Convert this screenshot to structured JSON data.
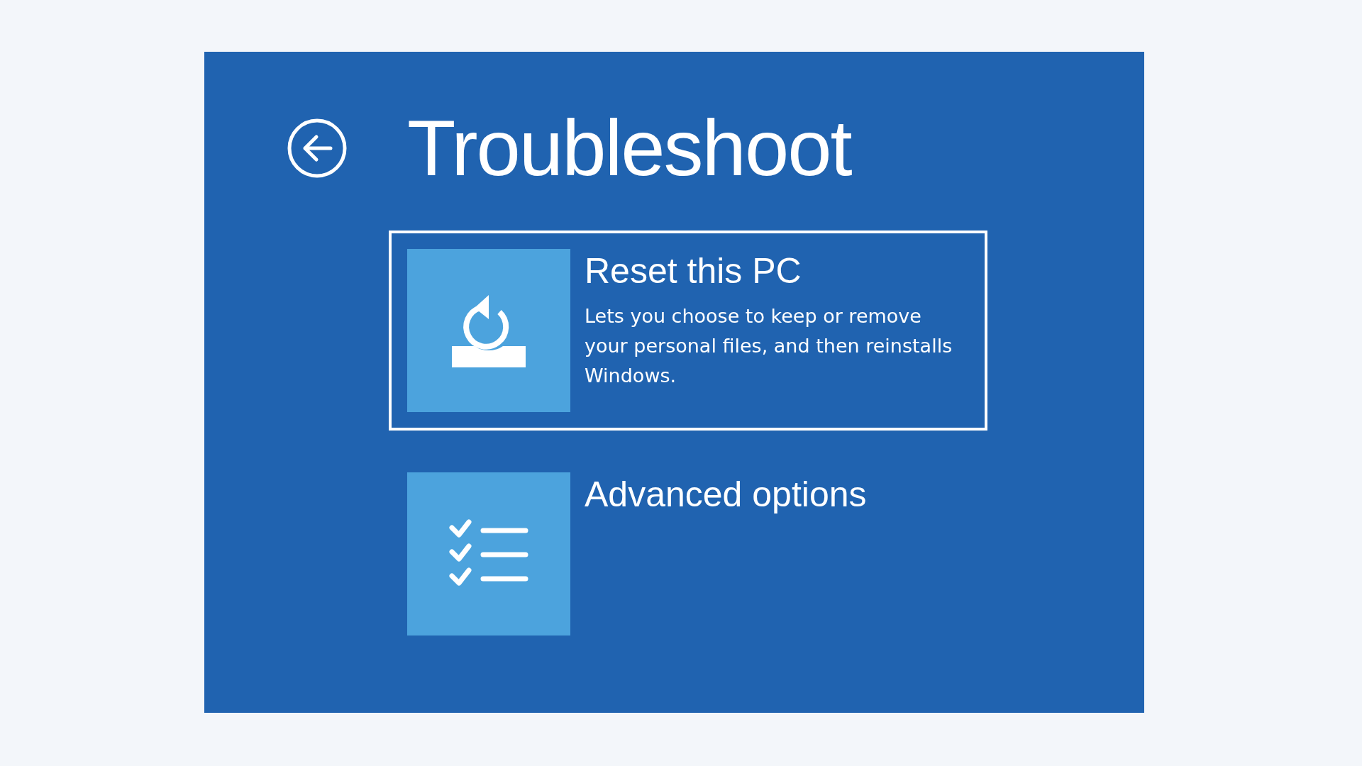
{
  "screen": {
    "title": "Troubleshoot"
  },
  "options": [
    {
      "kind": "reset",
      "title": "Reset this PC",
      "description": "Lets you choose to keep or remove your personal files, and then reinstalls Windows.",
      "selected": true
    },
    {
      "kind": "advanced",
      "title": "Advanced options",
      "selected": false
    }
  ]
}
